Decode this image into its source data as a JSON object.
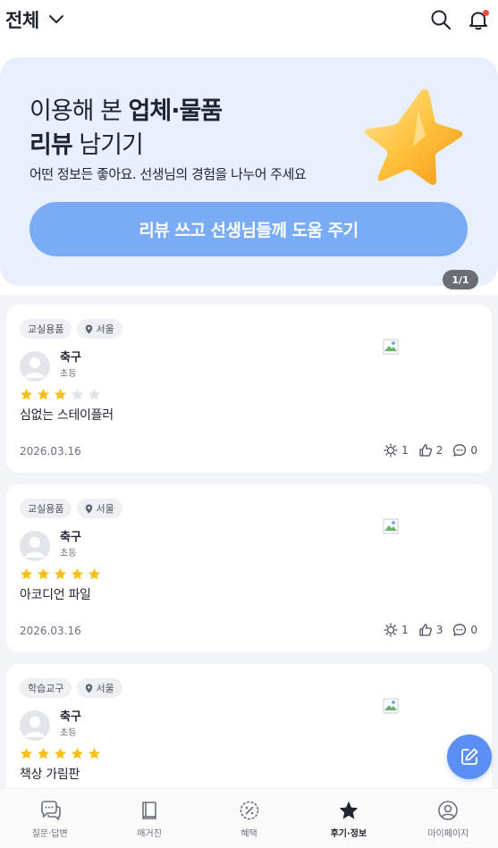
{
  "header": {
    "title": "전체",
    "dropdown_icon": "chevron-down-icon",
    "search_icon": "search-icon",
    "bell_icon": "bell-icon",
    "bell_has_notification": true
  },
  "banner": {
    "line1_normal": "이용해 본 ",
    "line1_bold": "업체·물품",
    "line2_bold": "리뷰",
    "line2_normal": " 남기기",
    "subtitle": "어떤 정보든 좋아요. 선생님의 경험을 나누어 주세요",
    "cta_label": "리뷰 쓰고 선생님들께 도움 주기",
    "page_indicator": "1/1",
    "background_color": "#e7f0fc",
    "cta_color": "#7aabf5"
  },
  "reviews": [
    {
      "category": "교실용품",
      "region": "서울",
      "author_name": "축구",
      "author_level": "초등",
      "rating": 3,
      "max_rating": 5,
      "product": "심없는 스테이플러",
      "date": "2026.03.16",
      "idea_count": "1",
      "like_count": "2",
      "comment_count": "0"
    },
    {
      "category": "교실용품",
      "region": "서울",
      "author_name": "축구",
      "author_level": "초등",
      "rating": 5,
      "max_rating": 5,
      "product": "아코디언 파일",
      "date": "2026.03.16",
      "idea_count": "1",
      "like_count": "3",
      "comment_count": "0"
    },
    {
      "category": "학습교구",
      "region": "서울",
      "author_name": "축구",
      "author_level": "초등",
      "rating": 5,
      "max_rating": 5,
      "product": "책상 가림판"
    }
  ],
  "fab": {
    "icon": "edit-icon",
    "color": "#5b8ff5"
  },
  "bottom_nav": [
    {
      "label": "질문·답변",
      "icon": "chat-bubble-icon",
      "active": false
    },
    {
      "label": "매거진",
      "icon": "book-icon",
      "active": false
    },
    {
      "label": "혜택",
      "icon": "discount-badge-icon",
      "active": false
    },
    {
      "label": "후기·정보",
      "icon": "star-icon",
      "active": true
    },
    {
      "label": "마이페이지",
      "icon": "user-circle-icon",
      "active": false
    }
  ],
  "colors": {
    "star_filled": "#f7bf1a",
    "star_empty": "#dfe2e7",
    "text_primary": "#1f2430",
    "text_secondary": "#6b7180"
  }
}
